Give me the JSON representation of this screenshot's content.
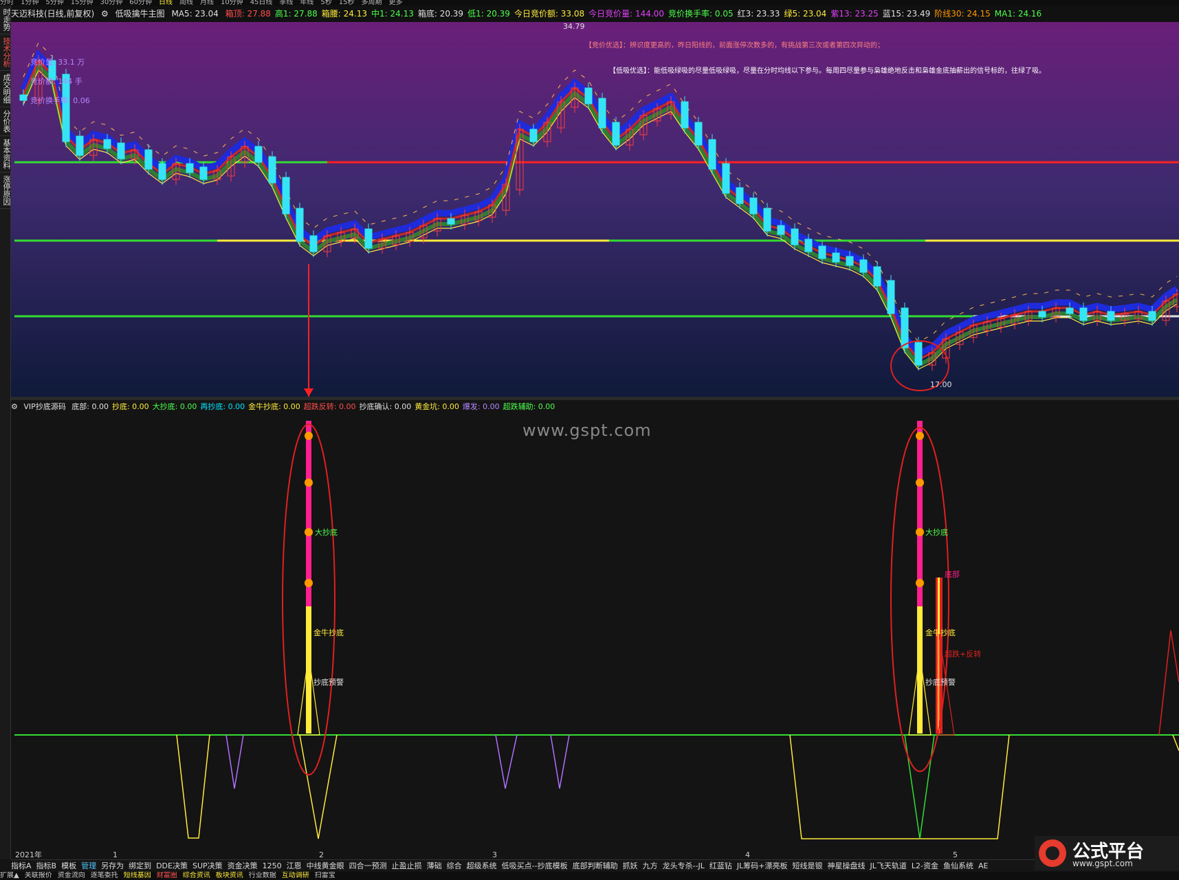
{
  "periods": [
    "分时",
    "1分钟",
    "5分钟",
    "15分钟",
    "30分钟",
    "60分钟",
    "日线",
    "周线",
    "月线",
    "10分钟",
    "45日线",
    "季线",
    "年线",
    "5秒",
    "15秒",
    "多周期",
    "更多"
  ],
  "active_period": "日线",
  "left_tabs": [
    "时走势",
    "技术分析",
    "成交明细",
    "分价表",
    "基本资料",
    "涨停原因"
  ],
  "main_header": {
    "stock": "天迈科技(日线,前复权)",
    "indicator": "低吸擒牛主图",
    "ma5": "MA5: 23.04",
    "items": [
      {
        "text": "箱顶: 27.88",
        "color": "red"
      },
      {
        "text": "高1: 27.88",
        "color": "grn"
      },
      {
        "text": "箱腰: 24.13",
        "color": "yel"
      },
      {
        "text": "中1: 24.13",
        "color": "grn"
      },
      {
        "text": "箱底: 20.39",
        "color": "wht"
      },
      {
        "text": "低1: 20.39",
        "color": "grn"
      },
      {
        "text": "今日竞价额: 33.08",
        "color": "yel"
      },
      {
        "text": "今日竞价量: 144.00",
        "color": "mag"
      },
      {
        "text": "竞价换手率: 0.05",
        "color": "grn"
      },
      {
        "text": "红3: 23.33",
        "color": "wht"
      },
      {
        "text": "绿5: 23.04",
        "color": "yel"
      },
      {
        "text": "紫13: 23.25",
        "color": "mag"
      },
      {
        "text": "蓝15: 23.49",
        "color": "wht"
      },
      {
        "text": "阶线30: 24.15",
        "color": "org"
      },
      {
        "text": "MA1: 24.16",
        "color": "grn"
      }
    ]
  },
  "annotations": {
    "high_price": "34.79",
    "low_price": "17.00",
    "bid_tip": "【竞价优选】：辨识度更高的，昨日阳线的，前面涨停次数多的，有挑战第三次或者第四次异动的；",
    "low_tip": "【低吸优选】：能低吸绿吸的尽量低吸绿吸，尽量在分时均线以下参与。每周四尽量参与枭雄绝地反击和枭雄金底抽薪出的信号标的，往绿了吸。",
    "left_labels": [
      "竞价量: 33.1 万",
      "竞价额: 144 手",
      "竞价换手率: 0.06"
    ]
  },
  "indicator_header": {
    "name": "VIP抄底源码",
    "items": [
      {
        "text": "底部: 0.00",
        "color": "wht"
      },
      {
        "text": "抄底: 0.00",
        "color": "yel"
      },
      {
        "text": "大抄底: 0.00",
        "color": "grn"
      },
      {
        "text": "再抄底: 0.00",
        "color": "cyan"
      },
      {
        "text": "金牛抄底: 0.00",
        "color": "yel"
      },
      {
        "text": "超跌反转: 0.00",
        "color": "red"
      },
      {
        "text": "抄底确认: 0.00",
        "color": "wht"
      },
      {
        "text": "黄金坑: 0.00",
        "color": "yel"
      },
      {
        "text": "爆发: 0.00",
        "color": "pur"
      },
      {
        "text": "超跌辅助: 0.00",
        "color": "grn"
      }
    ]
  },
  "signal_labels": {
    "big_bottom": "大抄底",
    "golden_bull": "金牛抄底",
    "warning": "抄底预警",
    "bottom": "底部",
    "reversal": "超跌+反转"
  },
  "watermark": "www.gspt.com",
  "date_axis": [
    "2021年",
    "1",
    "2",
    "3",
    "4",
    "5"
  ],
  "bottom_tabs": [
    "指标A",
    "指标B",
    "模板",
    "管理",
    "另存为",
    "绑定到",
    "DDE决策",
    "SUP决策",
    "资金决策",
    "1250",
    "江恩",
    "中线黄金眼",
    "四合一预测",
    "止盈止损",
    "薄础",
    "综合",
    "超级系统",
    "低吸买点--抄底模板",
    "底部判断辅助",
    "抓妖",
    "九方",
    "龙头专杀--JL",
    "红蓝钻",
    "JL筹码+漂亮板",
    "短线是银",
    "神星操盘线",
    "JL飞天轨道",
    "L2-资金",
    "鱼仙系统",
    "AE"
  ],
  "active_bottom_tab": "管理",
  "status_tabs": [
    {
      "text": "扩展▲",
      "style": ""
    },
    {
      "text": "关联报价",
      "style": ""
    },
    {
      "text": "资金流向",
      "style": ""
    },
    {
      "text": "逐笔委托",
      "style": ""
    },
    {
      "text": "短线基因",
      "style": "hot"
    },
    {
      "text": "财富圈",
      "style": "red"
    },
    {
      "text": "综合资讯",
      "style": "hot"
    },
    {
      "text": "板块资讯",
      "style": "hot"
    },
    {
      "text": "行业数据",
      "style": ""
    },
    {
      "text": "互动调研",
      "style": "hot"
    },
    {
      "text": "扫雷宝",
      "style": ""
    }
  ],
  "logo": {
    "text": "公式平台",
    "url": "www.gspt.com"
  },
  "colors": {
    "up": "#ff3b3b",
    "down": "#35e5f5",
    "box_top": "#ff2020",
    "box_line": "#33dd33",
    "mid_line": "#ffeb3b"
  }
}
